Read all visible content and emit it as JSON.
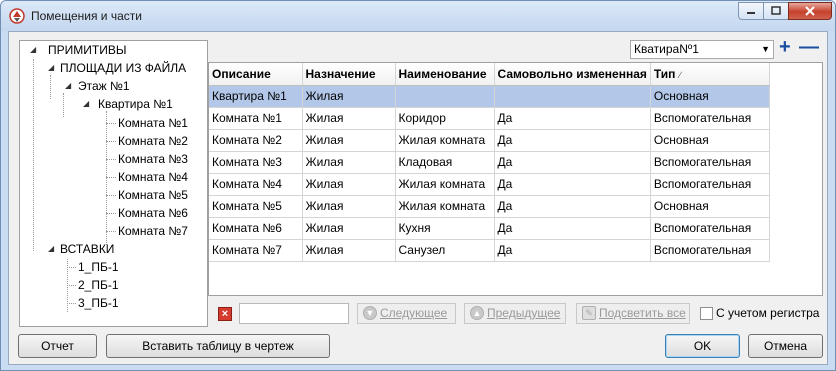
{
  "window": {
    "title": "Помещения и части"
  },
  "tree": {
    "root": "ПРИМИТИВЫ",
    "areas": "ПЛОЩАДИ ИЗ ФАЙЛА",
    "floor": "Этаж №1",
    "apartment": "Квартира №1",
    "rooms": [
      "Комната №1",
      "Комната №2",
      "Комната №3",
      "Комната №4",
      "Комната №5",
      "Комната №6",
      "Комната №7"
    ],
    "inserts": "ВСТАВКИ",
    "insert_items": [
      "1_ПБ-1",
      "2_ПБ-1",
      "3_ПБ-1"
    ]
  },
  "combo": {
    "value": "КватираNº1"
  },
  "table": {
    "headers": [
      "Описание",
      "Назначение",
      "Наименование",
      "Самовольно измененная",
      "Тип"
    ],
    "rows": [
      [
        "Квартира №1",
        "Жилая",
        "",
        "",
        "Основная"
      ],
      [
        "Комната №1",
        "Жилая",
        "Коридор",
        "Да",
        "Вспомогательная"
      ],
      [
        "Комната №2",
        "Жилая",
        "Жилая комната",
        "Да",
        "Основная"
      ],
      [
        "Комната №3",
        "Жилая",
        "Кладовая",
        "Да",
        "Вспомогательная"
      ],
      [
        "Комната №4",
        "Жилая",
        "Жилая комната",
        "Да",
        "Вспомогательная"
      ],
      [
        "Комната №5",
        "Жилая",
        "Жилая комната",
        "Да",
        "Основная"
      ],
      [
        "Комната №6",
        "Жилая",
        "Кухня",
        "Да",
        "Вспомогательная"
      ],
      [
        "Комната №7",
        "Жилая",
        "Санузел",
        "Да",
        "Вспомогательная"
      ]
    ]
  },
  "search": {
    "next_label": "Следующее",
    "prev_label": "Предыдущее",
    "highlight_label": "Подсветить все",
    "case_label": "С учетом регистра"
  },
  "buttons": {
    "report": "Отчет",
    "insert_table": "Вставить таблицу в чертеж",
    "ok": "OK",
    "cancel": "Отмена"
  },
  "colors": {
    "selected_row": "#b3c8e8",
    "accent": "#1a4fa0"
  }
}
